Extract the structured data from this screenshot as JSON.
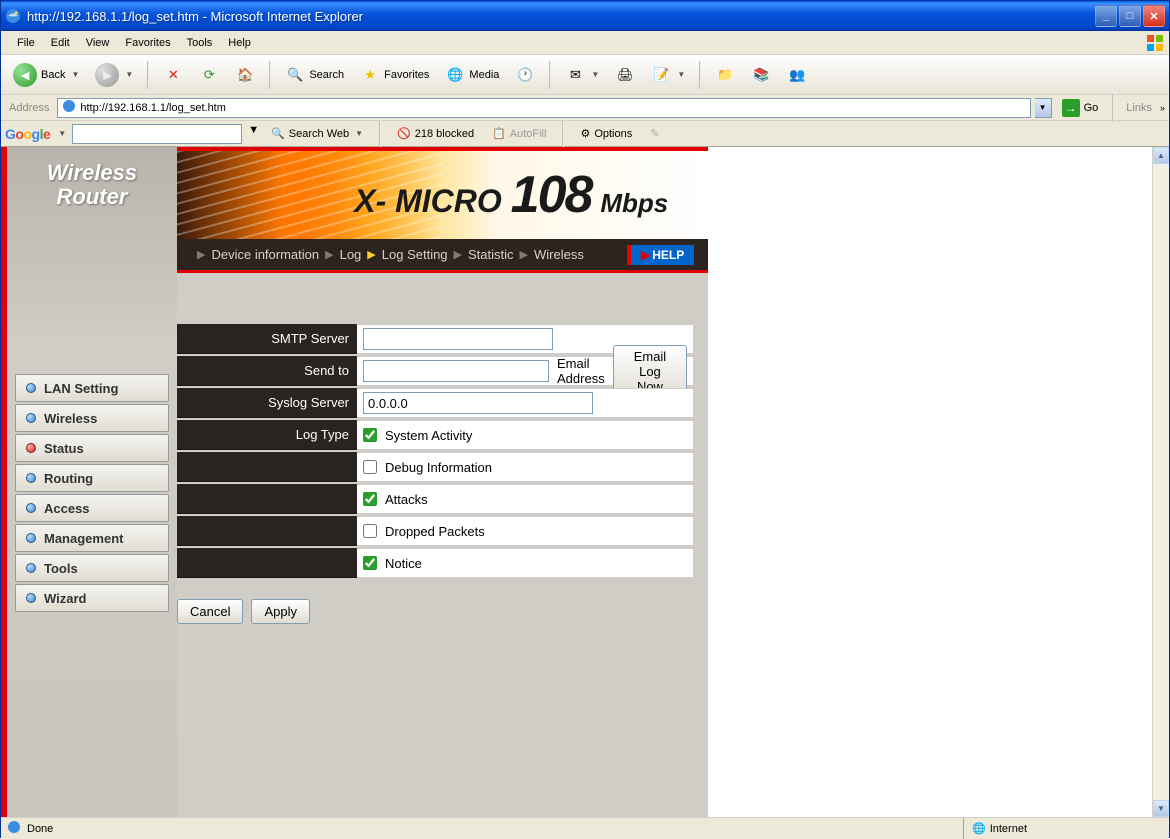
{
  "window": {
    "title": "http://192.168.1.1/log_set.htm - Microsoft Internet Explorer"
  },
  "menu": {
    "file": "File",
    "edit": "Edit",
    "view": "View",
    "favorites": "Favorites",
    "tools": "Tools",
    "help": "Help"
  },
  "toolbar": {
    "back": "Back",
    "search": "Search",
    "favorites": "Favorites",
    "media": "Media"
  },
  "address": {
    "label": "Address",
    "url": "http://192.168.1.1/log_set.htm",
    "go": "Go",
    "links": "Links"
  },
  "google": {
    "logo": "Google",
    "search_web": "Search Web",
    "blocked": "218 blocked",
    "autofill": "AutoFill",
    "options": "Options"
  },
  "sidebar": {
    "logo_line1": "Wireless",
    "logo_line2": "Router",
    "items": [
      {
        "label": "LAN Setting",
        "active": false
      },
      {
        "label": "Wireless",
        "active": false
      },
      {
        "label": "Status",
        "active": true
      },
      {
        "label": "Routing",
        "active": false
      },
      {
        "label": "Access",
        "active": false
      },
      {
        "label": "Management",
        "active": false
      },
      {
        "label": "Tools",
        "active": false
      },
      {
        "label": "Wizard",
        "active": false
      }
    ]
  },
  "banner": {
    "text_prefix": "X- MICRO",
    "text_big": "108",
    "text_suffix": "Mbps"
  },
  "subnav": {
    "items": [
      "Device information",
      "Log",
      "Log Setting",
      "Statistic",
      "Wireless"
    ],
    "active_index": 2,
    "help": "HELP"
  },
  "form": {
    "smtp_label": "SMTP Server",
    "smtp_value": "",
    "sendto_label": "Send to",
    "sendto_value": "",
    "email_address_text": "Email Address",
    "email_log_btn": "Email Log Now",
    "syslog_label": "Syslog Server",
    "syslog_value": "0.0.0.0",
    "logtype_label": "Log Type",
    "checkboxes": [
      {
        "label": "System Activity",
        "checked": true
      },
      {
        "label": "Debug Information",
        "checked": false
      },
      {
        "label": "Attacks",
        "checked": true
      },
      {
        "label": "Dropped Packets",
        "checked": false
      },
      {
        "label": "Notice",
        "checked": true
      }
    ],
    "cancel": "Cancel",
    "apply": "Apply"
  },
  "status": {
    "done": "Done",
    "zone": "Internet"
  }
}
